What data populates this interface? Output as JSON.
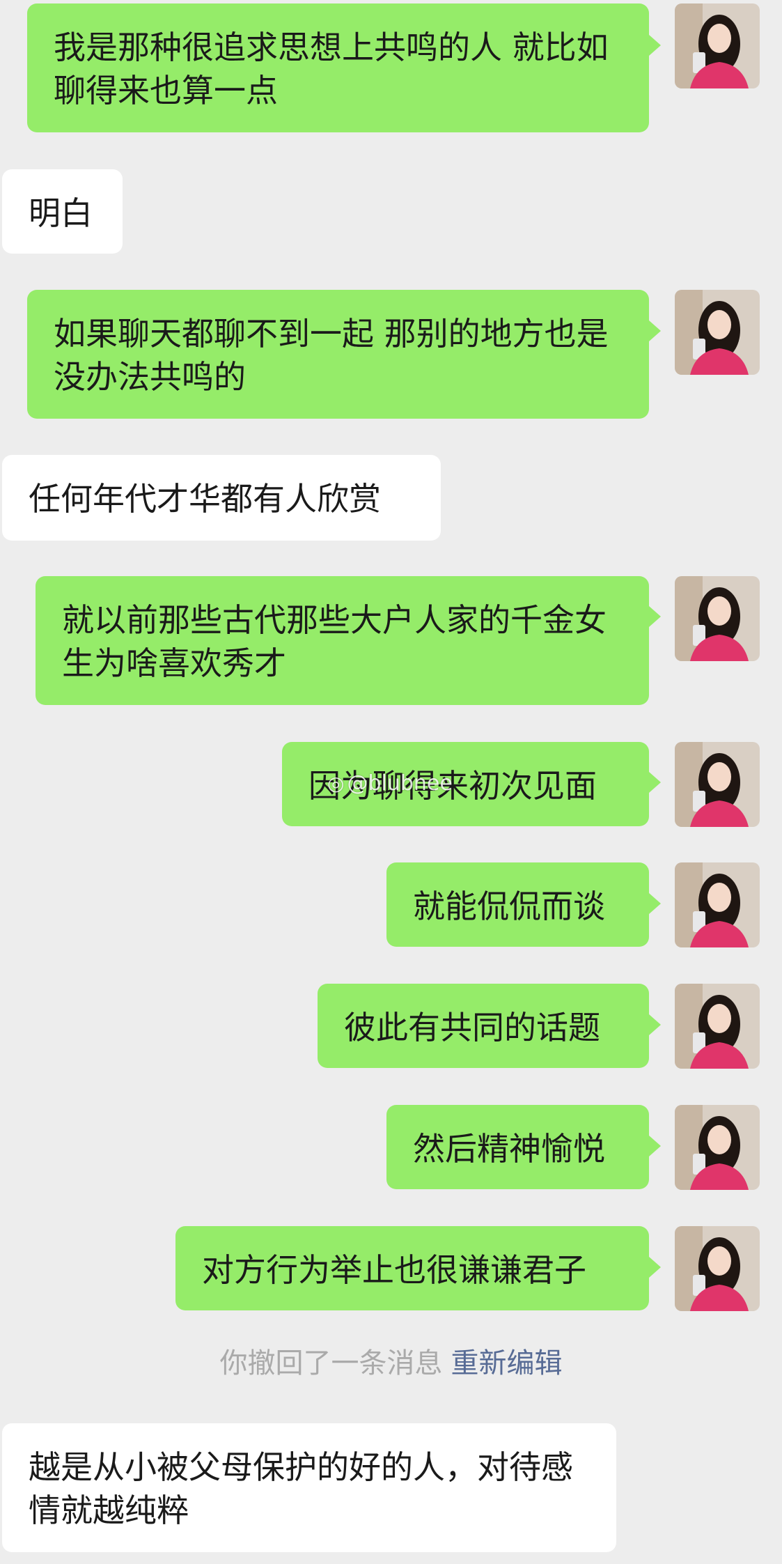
{
  "messages": [
    {
      "side": "sent",
      "text": "我是那种很追求思想上共鸣的人 就比如聊得来也算一点"
    },
    {
      "side": "recv",
      "text": "明白"
    },
    {
      "side": "sent",
      "text": "如果聊天都聊不到一起 那别的地方也是没办法共鸣的"
    },
    {
      "side": "recv",
      "text": "任何年代才华都有人欣赏"
    },
    {
      "side": "sent",
      "text": "就以前那些古代那些大户人家的千金女生为啥喜欢秀才"
    },
    {
      "side": "sent",
      "text": "因为聊得来初次见面"
    },
    {
      "side": "sent",
      "text": "就能侃侃而谈"
    },
    {
      "side": "sent",
      "text": "彼此有共同的话题"
    },
    {
      "side": "sent",
      "text": "然后精神愉悦"
    },
    {
      "side": "sent",
      "text": "对方行为举止也很谦谦君子"
    },
    {
      "side": "recv",
      "text": "越是从小被父母保护的好的人，对待感情就越纯粹"
    }
  ],
  "recall_notice": {
    "text": "你撤回了一条消息",
    "action_label": "重新编辑"
  },
  "watermark": {
    "text": "@blubnee"
  },
  "colors": {
    "background": "#ededed",
    "sent_bubble": "#95ec69",
    "received_bubble": "#ffffff",
    "link": "#576b95",
    "system_text": "#aaaaaa"
  }
}
